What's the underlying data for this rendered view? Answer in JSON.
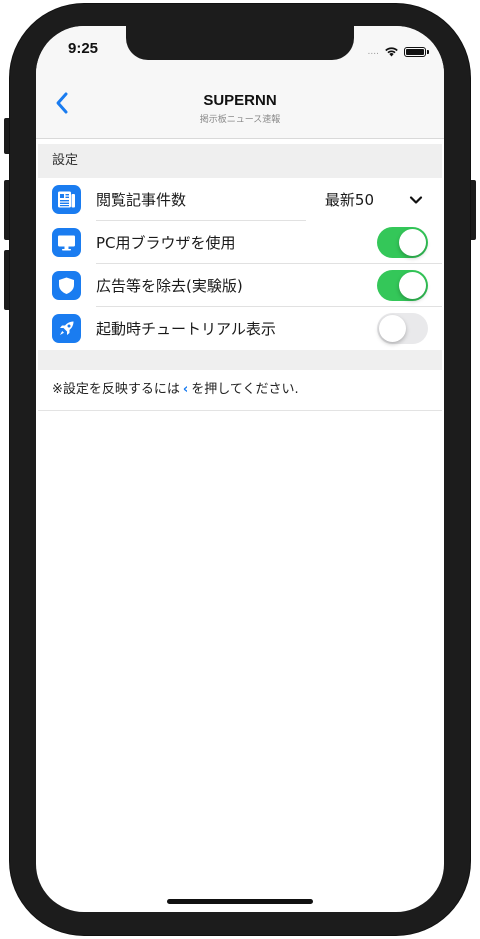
{
  "status_bar": {
    "time": "9:25",
    "signal": "....",
    "wifi_icon": "wifi-icon",
    "battery_icon": "battery-icon"
  },
  "nav": {
    "back_icon": "chevron-left-icon",
    "title": "SUPERNN",
    "subtitle": "掲示板ニュース速報"
  },
  "settings": {
    "section_title": "設定",
    "rows": [
      {
        "icon": "newspaper-icon",
        "label": "閲覧記事件数",
        "value": "最新50",
        "control": "chevron-down-icon"
      },
      {
        "icon": "monitor-icon",
        "label": "PC用ブラウザを使用",
        "toggle": true
      },
      {
        "icon": "shield-icon",
        "label": "広告等を除去(実験版)",
        "toggle": true
      },
      {
        "icon": "rocket-icon",
        "label": "起動時チュートリアル表示",
        "toggle": false
      }
    ]
  },
  "note": {
    "prefix": "※設定を反映するには",
    "chevron": "‹",
    "suffix": "を押してください."
  },
  "colors": {
    "accent": "#1a7cf0",
    "toggle_on": "#34c759",
    "toggle_off": "#e9e9eb",
    "frame": "#1c1c1c"
  }
}
